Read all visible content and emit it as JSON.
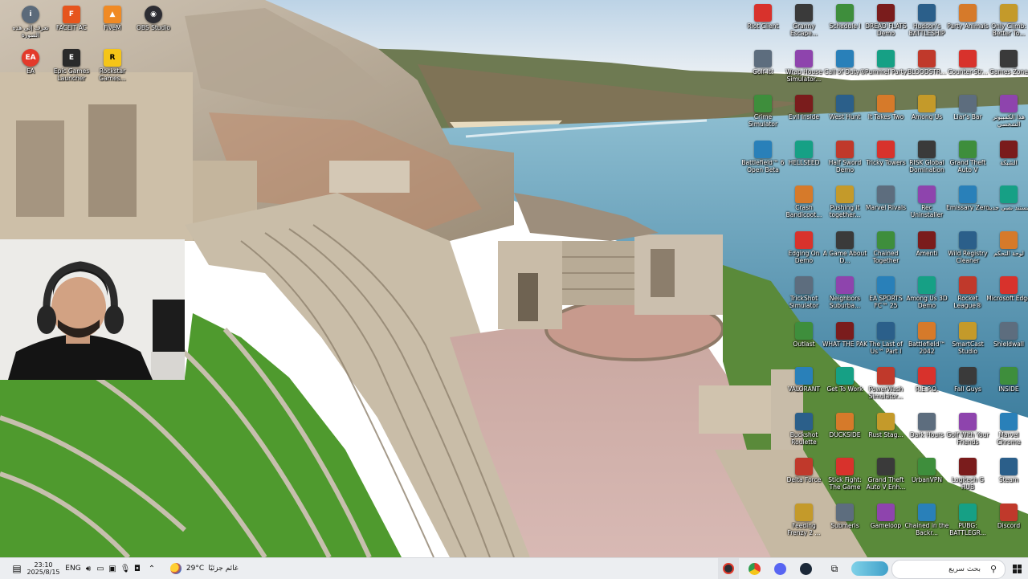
{
  "left_icons": [
    {
      "label": "تعرف إلى هذه الصورة",
      "icon": "info-icon",
      "color": "#5b6a7a"
    },
    {
      "label": "FACEIT AC",
      "icon": "faceit-icon",
      "color": "#e6551d"
    },
    {
      "label": "FiveM",
      "icon": "fivem-icon",
      "color": "#f08a24"
    },
    {
      "label": "OBS Studio",
      "icon": "obs-icon",
      "color": "#2d2d33"
    },
    {
      "label": "EA",
      "icon": "ea-icon",
      "color": "#e33a2b"
    },
    {
      "label": "Epic Games Launcher",
      "icon": "epic-icon",
      "color": "#2a2a2a"
    },
    {
      "label": "Rockstar Games...",
      "icon": "rockstar-icon",
      "color": "#f5c518"
    }
  ],
  "right_icons": [
    [
      "Riot Client",
      "Granny Escape...",
      "Schedule I",
      "DREAD FLATS Demo",
      "Hudson's BATTLESHIP",
      "Party Animals",
      "Only Climb: Better To..."
    ],
    [
      "Golf It!",
      "Wrap House Simulator...",
      "Call of Duty®",
      "Pummel Party",
      "BLOODSTR...",
      "Counter-Str...",
      "Games Zone"
    ],
    [
      "Crime Simulator",
      "Evil Inside",
      "West Hunt",
      "It Takes Two",
      "Among Us",
      "Liar's Bar",
      "هذا الكمبيوتر الشخصي"
    ],
    [
      "Battlefield™ 6 Open Beta",
      "HELLSEED",
      "Half Sword Demo",
      "Tricky Towers",
      "RISK Global Domination",
      "Grand Theft Auto V",
      "الشبكة"
    ],
    [
      "Crash Bandicoot...",
      "Pushing it together...",
      "Marvel Rivals",
      "Rec Uninstaller",
      "Emissary Zero",
      "مستند نصي جديد"
    ],
    [
      "Edging On Demo",
      "A Game About D...",
      "Chained Together",
      "Amenti",
      "Wild Registry Cleaner",
      "لوحة التحكم"
    ],
    [
      "TrickShot Simulator",
      "Neighbors Suburba...",
      "EA SPORTS FC™ 25",
      "Among Us 3D Demo",
      "Rocket League®",
      "Microsoft Edge"
    ],
    [
      "Outlast",
      "WHAT THE PAK",
      "The Last of Us™ Part I",
      "Battlefield™ 2042",
      "SmartCast Studio",
      "Shieldwall"
    ],
    [
      "VALORANT",
      "Get To Work",
      "PowerWash Simulator...",
      "R.E.P.O.",
      "Fall Guys",
      "INSIDE"
    ],
    [
      "Buckshot Roulette",
      "DUCKSIDE",
      "Rust Stag...",
      "Dark Hours",
      "Golf With Your Friends",
      "Marvel Chrome"
    ],
    [
      "Delta Force",
      "Stick Fight: The Game",
      "Grand Theft Auto V Enh...",
      "UrbanVPN",
      "Logitech G HUB",
      "Steam"
    ],
    [
      "Feeding Frenzy 2 ...",
      "Submeris",
      "Gameloop",
      "Chained in the Backr...",
      "PUBG: BATTLEGR...",
      "Discord"
    ]
  ],
  "taskbar": {
    "time": "23:10",
    "date": "2025/8/15",
    "language": "ENG",
    "weather_temp": "29°C",
    "weather_text": "غائم جزئيًا",
    "search_placeholder": "بحث سريع"
  },
  "colors": {
    "taskbar_bg": "#eceef1",
    "sea": "#5e9bb8",
    "grass": "#4f9a2e",
    "stone": "#b8a892"
  }
}
